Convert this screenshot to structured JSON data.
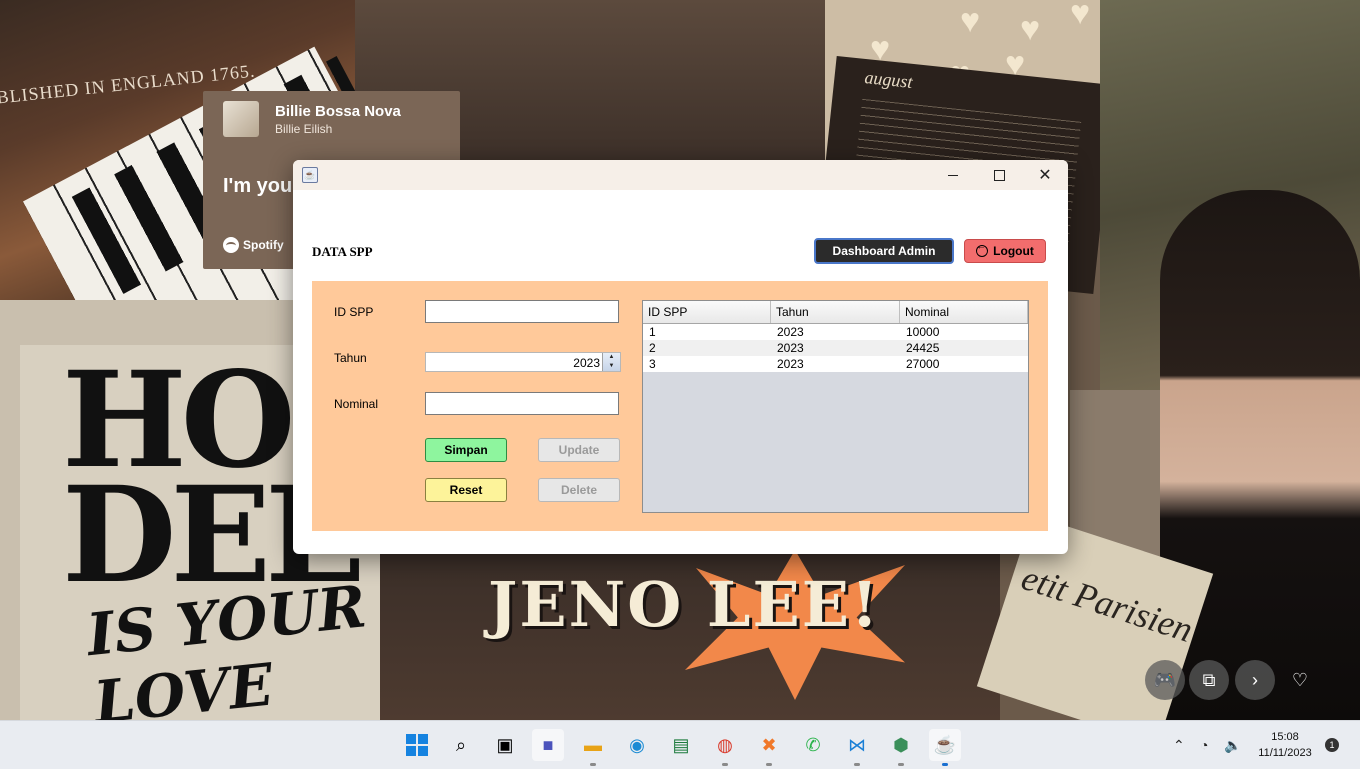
{
  "wallpaper": {
    "piano_text": "BLISHED IN ENGLAND 1765.",
    "august_title": "august",
    "poster_line1": "HO",
    "poster_line2": "DEE",
    "poster_line3": "IS YOUR LOVE",
    "jeno_text": "JENO LEE!",
    "paper_text": "etit Parisien"
  },
  "spotify_widget": {
    "track_title": "Billie Bossa Nova",
    "artist": "Billie Eilish",
    "lyric": "I'm you",
    "brand": "Spotify"
  },
  "window": {
    "controls": {
      "minimize": "minimize",
      "maximize": "maximize",
      "close": "✕"
    }
  },
  "header": {
    "title": "DATA SPP",
    "dashboard_button": "Dashboard Admin",
    "logout_button": "Logout"
  },
  "form": {
    "id_label": "ID SPP",
    "id_value": "",
    "tahun_label": "Tahun",
    "tahun_value": "2023",
    "nominal_label": "Nominal",
    "nominal_value": "",
    "simpan_button": "Simpan",
    "update_button": "Update",
    "reset_button": "Reset",
    "delete_button": "Delete"
  },
  "table": {
    "columns": [
      "ID SPP",
      "Tahun",
      "Nominal"
    ],
    "rows": [
      [
        "1",
        "2023",
        "10000"
      ],
      [
        "2",
        "2023",
        "24425"
      ],
      [
        "3",
        "2023",
        "27000"
      ]
    ]
  },
  "overlay_buttons": [
    "gamepad-icon",
    "copy-icon",
    "next-icon",
    "heart-icon"
  ],
  "taskbar": {
    "time": "15:08",
    "date": "11/11/2023",
    "notification_count": "1"
  },
  "colors": {
    "panel": "#ffc99a",
    "simpan": "#8ef59e",
    "reset": "#fdf39a",
    "logout": "#f26d6d",
    "dashboard": "#2b2b2b"
  }
}
